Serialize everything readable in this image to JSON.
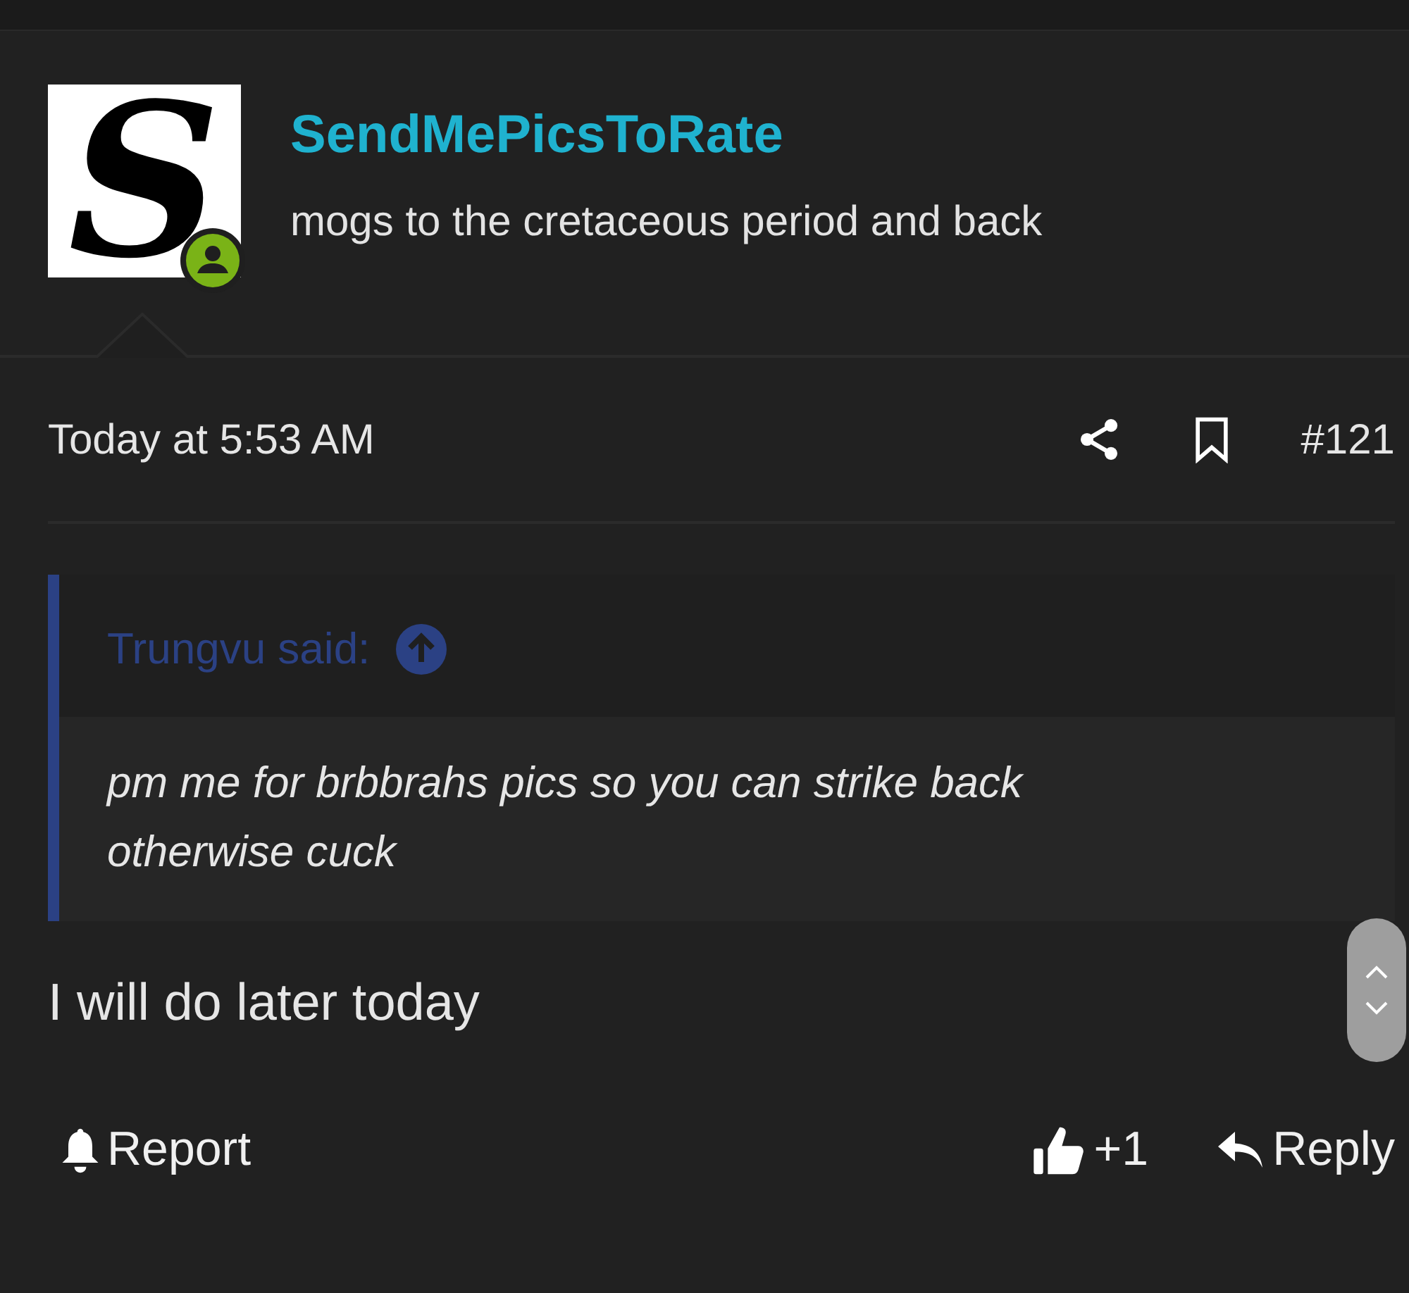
{
  "author": {
    "avatar_letter": "S",
    "name": "SendMePicsToRate",
    "title": "mogs to the cretaceous period and back",
    "online": true
  },
  "meta": {
    "time": "Today at 5:53 AM",
    "post_number": "#121"
  },
  "quote": {
    "author": "Trungvu said:",
    "text": "pm me for brbbrahs pics so you can strike back otherwise cuck"
  },
  "body": "I will do later today",
  "footer": {
    "report": "Report",
    "reactions": "+1",
    "reply": "Reply"
  }
}
